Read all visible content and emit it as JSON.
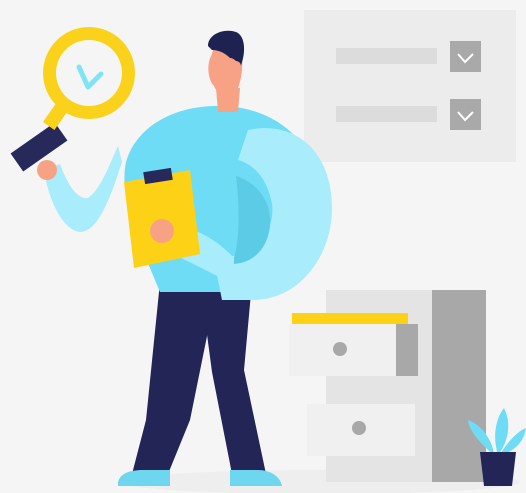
{
  "illustration": {
    "subject": "person-with-magnifier-and-clipboard",
    "colors": {
      "background": "#f6f5f6",
      "panel": "#ececec",
      "panel_row": "#dcdcdc",
      "checkbox": "#a9a9a9",
      "check_mark": "#ffffff",
      "magnifier_yellow": "#fad21b",
      "magnifier_handle": "#26295a",
      "magnifier_check": "#7fe4f5",
      "skin": "#f7a285",
      "hair": "#1e2250",
      "shirt": "#6fdcf6",
      "sleeve_light": "#a9ecfb",
      "sleeve_shadow": "#5ccbe6",
      "clipboard": "#fcd116",
      "clipboard_clip": "#26295a",
      "pants": "#232556",
      "shoes": "#6fd6f0",
      "cabinet": "#e4e4e4",
      "cabinet_side": "#a8a8a8",
      "drawer": "#f0f0f0",
      "drawer_knob": "#a8a8a8",
      "folder_yellow": "#fcd116",
      "plant_leaf": "#6fdcf6",
      "plant_pot": "#232556",
      "floor": "#eeeeee"
    },
    "icons": [
      "magnifier-icon",
      "check-icon",
      "chevron-down-icon",
      "clipboard-icon",
      "plant-icon",
      "cabinet-icon"
    ]
  }
}
